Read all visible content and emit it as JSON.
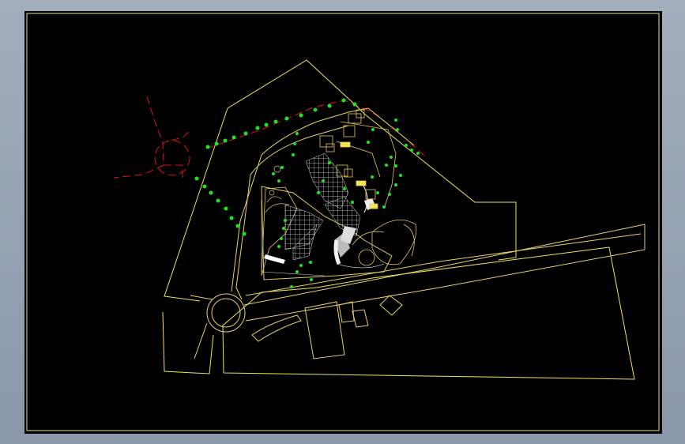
{
  "drawing": {
    "kind": "cad-site-plan",
    "background": "#000000",
    "layer_colors": {
      "boundary": "#f2e45a",
      "building": "#e6c85c",
      "road": "#e9d36a",
      "vegetation": "#1fe51f",
      "red_line": "#e01010",
      "hatch": "#e8e8e8",
      "frame": "#e8e2a0"
    }
  }
}
